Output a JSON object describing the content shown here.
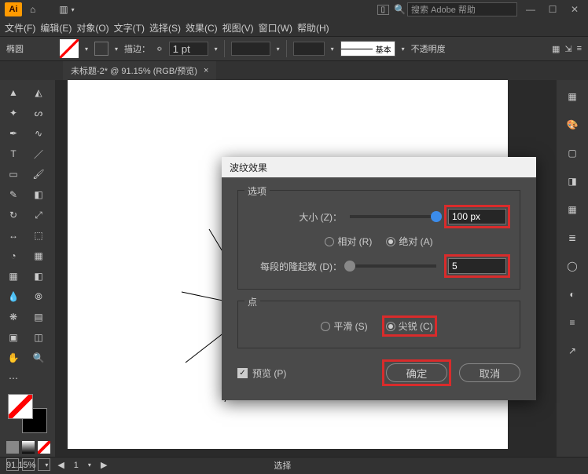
{
  "titlebar": {
    "logo_text": "Ai",
    "search_placeholder": "搜索 Adobe 帮助"
  },
  "menubar": {
    "items": [
      "文件(F)",
      "编辑(E)",
      "对象(O)",
      "文字(T)",
      "选择(S)",
      "效果(C)",
      "视图(V)",
      "窗口(W)",
      "帮助(H)"
    ]
  },
  "controlbar": {
    "shape_label": "椭圆",
    "stroke_label": "描边：",
    "stroke_value": "1 pt",
    "style_label": "基本",
    "opacity_label": "不透明度"
  },
  "doctab": {
    "title": "未标题-2* @ 91.15% (RGB/预览)"
  },
  "dialog": {
    "title": "波纹效果",
    "group_option": "选项",
    "label_size": "大小 (Z)：",
    "value_size": "100 px",
    "radio_relative": "相对 (R)",
    "radio_absolute": "绝对 (A)",
    "label_ridges": "每段的隆起数 (D)：",
    "value_ridges": "5",
    "group_point": "点",
    "radio_smooth": "平滑 (S)",
    "radio_corner": "尖锐 (C)",
    "preview_label": "预览 (P)",
    "ok_label": "确定",
    "cancel_label": "取消"
  },
  "status": {
    "zoom": "91.15%",
    "page": "1",
    "tool": "选择"
  },
  "icons": {
    "home": "⌂",
    "min": "—",
    "max": "☐",
    "close": "✕",
    "search": "🔍",
    "sel": "▲",
    "dsel": "◭",
    "wand": "✦",
    "lasso": "◯",
    "pen": "✒",
    "curve": "∿",
    "type": "T",
    "line": "／",
    "rect": "▭",
    "brush": "🖌",
    "rotate": "↻",
    "erase": "⌫",
    "scissors": "✂",
    "scale": "⤢",
    "knife": "✎",
    "mesh": "▦",
    "grad": "◧",
    "eyedrop": "💧",
    "blend": "⦾",
    "symbol": "❋",
    "chart": "▤",
    "artb": "▣",
    "slice": "◫",
    "hand": "✋",
    "zoom": "🔍",
    "dots": "⋯",
    "props": "▦",
    "color": "🎨",
    "libs": "▢",
    "grad2": "◨",
    "swat": "▦",
    "layers": "≣",
    "appear": "◯",
    "trans": "◐",
    "links": "🔗",
    "share": "↗"
  }
}
